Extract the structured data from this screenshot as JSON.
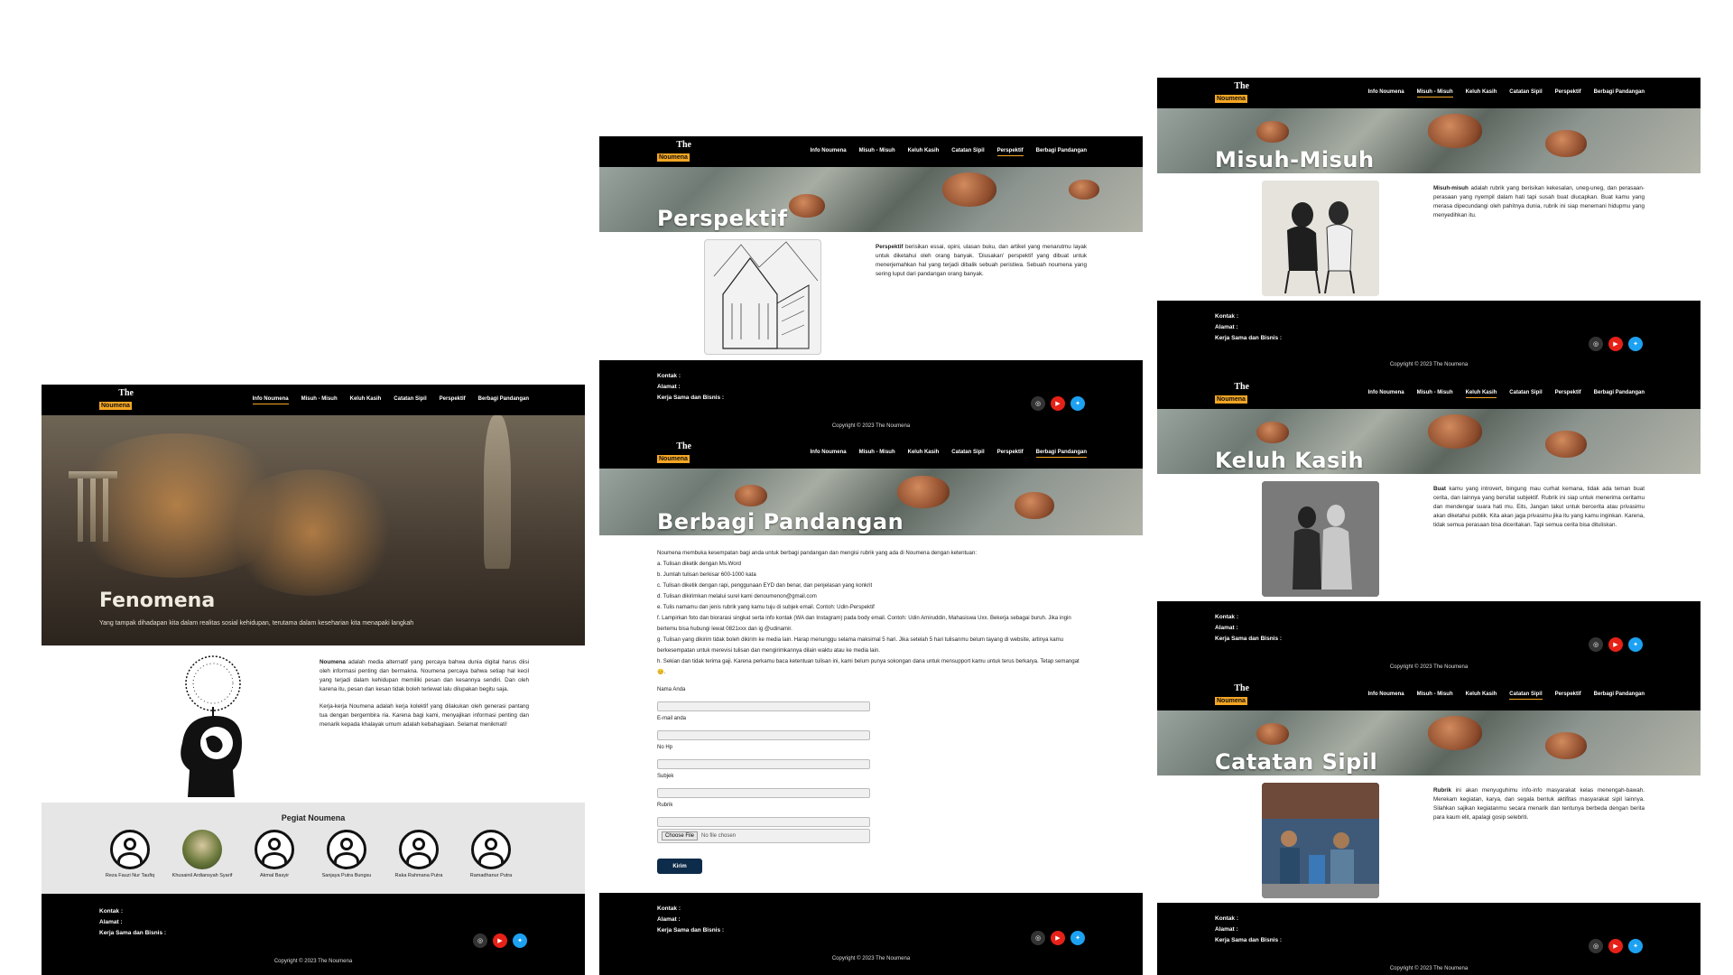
{
  "logo": {
    "top": "The",
    "bottom": "Noumena"
  },
  "nav": [
    "Info Noumena",
    "Misuh - Misuh",
    "Keluh Kasih",
    "Catatan Sipil",
    "Perspektif",
    "Berbagi Pandangan"
  ],
  "footer": {
    "kontak": "Kontak :",
    "alamat": "Alamat :",
    "kerja": "Kerja Sama dan Bisnis :",
    "copyright": "Copyright © 2023 The Noumena"
  },
  "social": {
    "ig": "◎",
    "yt": "▶",
    "tw": "✦"
  },
  "info": {
    "hero_title": "Fenomena",
    "hero_sub": "Yang tampak dihadapan kita dalam realitas sosial kehidupan, terutama dalam keseharian kita menapaki langkah",
    "para1_bold": "Noumena",
    "para1": " adalah media alternatif yang percaya bahwa dunia digital harus diisi oleh informasi penting dan bermakna. Noumena percaya bahwa setiap hal kecil yang terjadi dalam kehidupan memiliki pesan dan kesannya sendiri. Dan oleh karena itu, pesan dan kesan tidak boleh terlewat lalu dilupakan begitu saja.",
    "para2": "Kerja-kerja Noumena adalah kerja kolektif yang dilakukan oleh generasi pantang tua dengan bergembira ria. Karena bagi kami, menyajikan informasi penting dan menarik kepada khalayak umum adalah kebahagiaan. Selamat menikmati!",
    "team_title": "Pegiat Noumena",
    "team": [
      "Reza Fauzi Nur Taufiq",
      "Khusainil Ardiansyah Syarif",
      "Akmal Basyir",
      "Sanjaya Putra Bungsu",
      "Raka Rahmana Putra",
      "Ramadhanur Putra"
    ]
  },
  "perspektif": {
    "title": "Perspektif",
    "bold": "Perspektif",
    "text": " berisikan essai, opini, ulasan buku, dan artikel yang menarutmu layak untuk diketahui oleh orang banyak. 'Diusakan' perspektif yang dibuat untuk menerjemahkan hal yang terjadi dibalik sebuah peristiwa. Sebuah noumena yang sering luput dari pandangan orang banyak."
  },
  "berbagi": {
    "title": "Berbagi Pandangan",
    "intro": "Noumena membuka kesempatan bagi anda untuk berbagi pandangan dan mengisi rubrik yang ada di Noumena dengan ketentuan:",
    "rules": [
      "a. Tulisan diketik dengan Ms.Word",
      "b. Jumlah tulisan berkisar 600-1000 kata",
      "c. Tulisan diketik dengan rapi, penggunaan EYD dan benar, dan penjelasan yang konkrit",
      "d. Tulisan dikirimkan melalui surel kami denoumenon@gmail.com",
      "e. Tulis namamu dan jenis rubrik yang kamu tuju di subjek email. Contoh: Udin-Perspektif",
      "f. Lampirkan foto dan biorarasi singkat serta info kontak (WA dan Instagram) pada body email. Contoh: Udin Amiruddin, Mahasiswa Uxx. Bekerja sebagai buruh. Jika ingin bertemu bisa hubungi lewat 0821xxx dan ig @udinamir.",
      "g. Tulisan yang dikirim tidak boleh dikirim ke media lain. Harap menunggu selama maksimal 5 hari. Jika setelah 5 hari tulisanmu belum tayang di website, artinya kamu berkesempatan untuk merevisi tulisan dan mengirimkannya dilain waktu atau ke media lain.",
      "h. Sekian dan tidak terima gaji. Karena perkamu baca ketentuan tulisan ini, kami belum punya sokongan dana untuk mensupport kamu untuk terus berkarya. Tetap semangat 😊."
    ],
    "fields": [
      "Nama Anda",
      "E-mail anda",
      "No Hp",
      "Subjek",
      "Rubrik"
    ],
    "file_button": "Choose File",
    "file_status": "No file chosen",
    "submit": "Kirim"
  },
  "misuh": {
    "title": "Misuh-Misuh",
    "bold": "Misuh-misuh",
    "text": " adalah rubrik yang berisikan kekesalan, uneg-uneg, dan perasaan-perasaan yang nyempil dalam hati tapi susah buat diucapkan. Buat kamu yang merasa dipecundangi oleh pahitnya dunia, rubrik ini siap menemani hidupmu yang menyedihkan itu."
  },
  "keluh": {
    "title": "Keluh Kasih",
    "bold": "Buat",
    "text": " kamu yang introvert, bingung mau curhat kemana, tidak ada teman buat cerita, dan lainnya yang bersifat subjektif. Rubrik ini siap untuk menerima ceritamu dan mendengar suara hati mu. Eits, Jangan takut untuk bercerita atau privasimu akan diketahui publik. Kita akan jaga privasimu jika itu yang kamu inginkan. Karena, tidak semua perasaan bisa diceritakan. Tapi semua cerita bisa dituliskan."
  },
  "catatan": {
    "title": "Catatan Sipil",
    "bold": "Rubrik",
    "text": " ini akan menyuguhimu info-info masyarakat kelas menengah-bawah. Merekam kegiatan, karya, dan segala bentuk aktifitas masyarakat sipil lainnya. Silahkan sajikan kegiatanmu secara menarik dan tentunya berbeda dengan berita para kaum elit, apalagi gosip selebriti."
  }
}
